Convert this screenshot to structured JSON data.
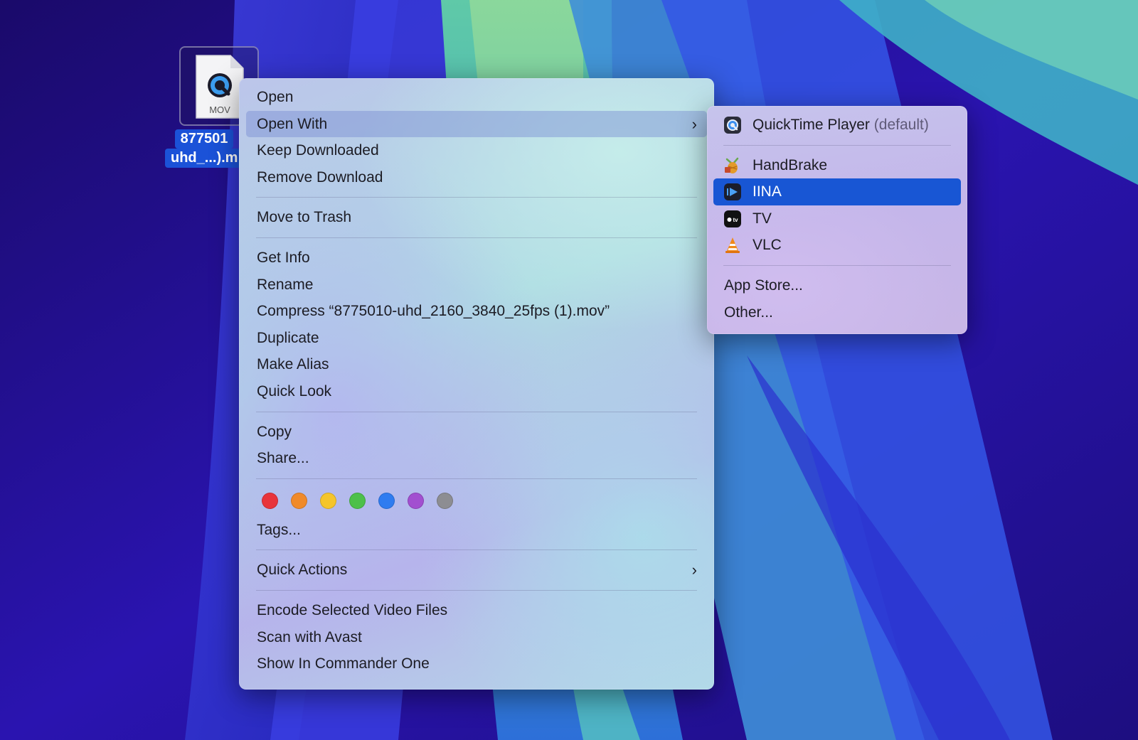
{
  "desktop": {
    "file": {
      "type_label": "MOV",
      "name_line1": "877501",
      "name_line2": "uhd_...).m"
    }
  },
  "context_menu": {
    "open": "Open",
    "open_with": "Open With",
    "keep_downloaded": "Keep Downloaded",
    "remove_download": "Remove Download",
    "move_to_trash": "Move to Trash",
    "get_info": "Get Info",
    "rename": "Rename",
    "compress": "Compress “8775010-uhd_2160_3840_25fps (1).mov”",
    "duplicate": "Duplicate",
    "make_alias": "Make Alias",
    "quick_look": "Quick Look",
    "copy": "Copy",
    "share": "Share...",
    "tag_colors": [
      "#e8343b",
      "#f08a2a",
      "#f5c52b",
      "#4dc04a",
      "#2f7cf0",
      "#a24fd0",
      "#8d8d92"
    ],
    "tags": "Tags...",
    "quick_actions": "Quick Actions",
    "encode_video": "Encode Selected Video Files",
    "scan_avast": "Scan with Avast",
    "show_commander": "Show In Commander One",
    "chevron": "›"
  },
  "open_with_submenu": {
    "default_app": "QuickTime Player",
    "default_tag": "(default)",
    "apps": [
      "HandBrake",
      "IINA",
      "TV",
      "VLC"
    ],
    "selected_app": "IINA",
    "app_store": "App Store...",
    "other": "Other..."
  },
  "colors": {
    "selection_blue": "#1856d4"
  }
}
